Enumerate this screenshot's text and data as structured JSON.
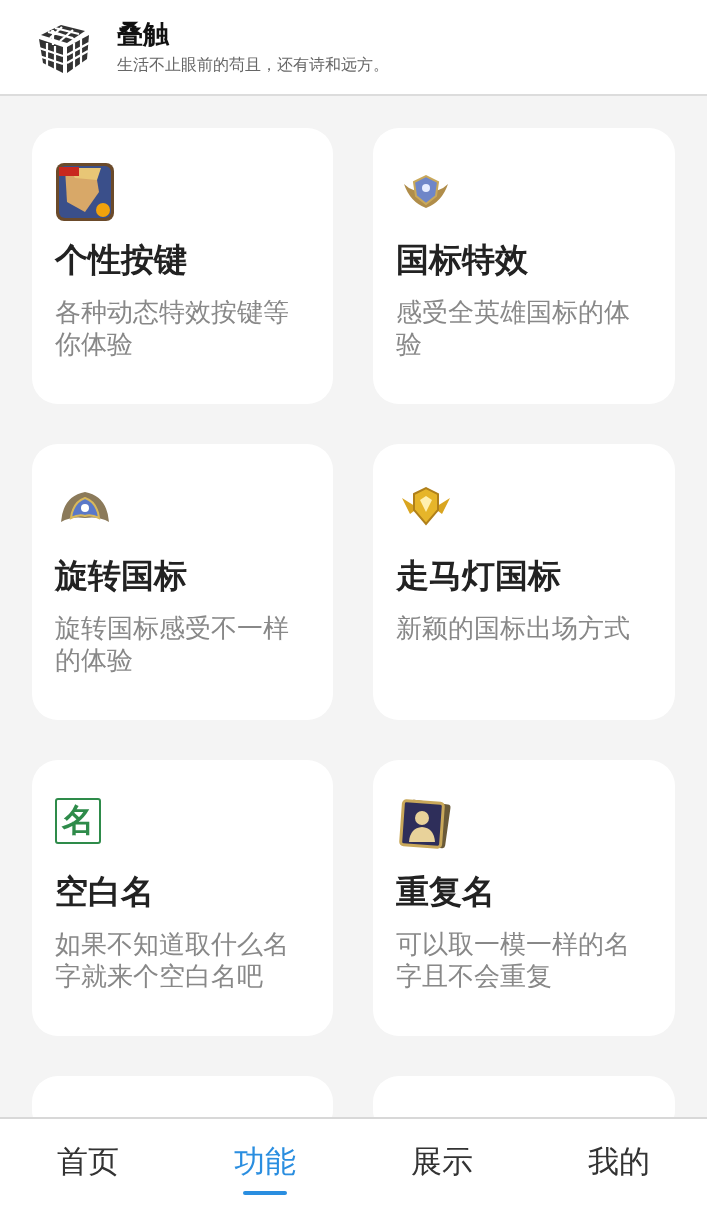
{
  "header": {
    "title": "叠触",
    "subtitle": "生活不止眼前的苟且，还有诗和远方。"
  },
  "cards": [
    {
      "kind": "game-app",
      "title": "个性按键",
      "description": "各种动态特效按键等你体验"
    },
    {
      "kind": "emblem-crest",
      "title": "国标特效",
      "description": "感受全英雄国标的体验"
    },
    {
      "kind": "emblem-winged",
      "title": "旋转国标",
      "description": "旋转国标感受不一样的体验"
    },
    {
      "kind": "emblem-gold",
      "title": "走马灯国标",
      "description": "新颖的国标出场方式"
    },
    {
      "kind": "name-tile",
      "icon_text": "名",
      "title": "空白名",
      "description": "如果不知道取什么名字就来个空白名吧"
    },
    {
      "kind": "portrait-cards",
      "title": "重复名",
      "description": "可以取一模一样的名字且不会重复"
    }
  ],
  "tabs": [
    {
      "label": "首页",
      "selected": false
    },
    {
      "label": "功能",
      "selected": true
    },
    {
      "label": "展示",
      "selected": false
    },
    {
      "label": "我的",
      "selected": false
    }
  ]
}
